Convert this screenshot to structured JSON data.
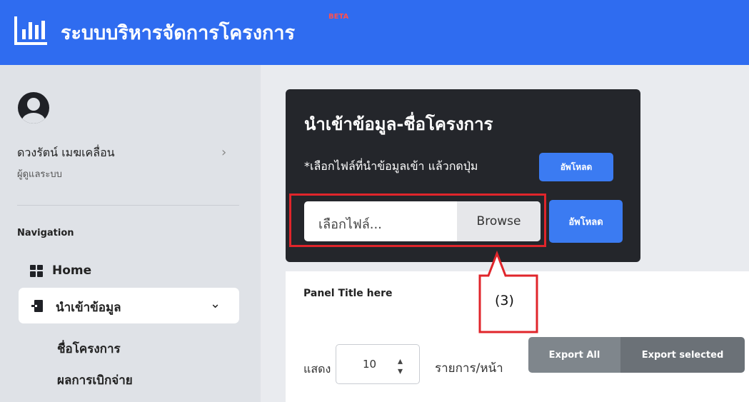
{
  "header": {
    "app_title": "ระบบบริหารจัดการโครงการ",
    "beta_badge": "BETA",
    "logo_icon": "bar-chart-icon"
  },
  "sidebar": {
    "user": {
      "name": "ดวงรัตน์ เมฆเคลื่อน",
      "role": "ผู้ดูแลระบบ"
    },
    "nav_heading": "Navigation",
    "items": [
      {
        "label": "Home",
        "icon": "dashboard-grid-icon"
      },
      {
        "label": "นำเข้าข้อมูล",
        "icon": "file-import-icon",
        "expanded": true,
        "children": [
          "ชื่อโครงการ",
          "ผลการเบิกจ่าย"
        ]
      }
    ]
  },
  "import_card": {
    "title": "นำเข้าข้อมูล-ชื่อโครงการ",
    "hint": "*เลือกไฟล์ที่นำข้อมูลเข้า แล้วกดปุ่ม",
    "upload_label": "อัพโหลด",
    "file_placeholder": "เลือกไฟล์...",
    "browse_label": "Browse"
  },
  "panel": {
    "title": "Panel Title here",
    "show_label": "แสดง",
    "page_size": "10",
    "per_page_label": "รายการ/หน้า",
    "export_all_label": "Export All",
    "export_selected_label": "Export selected"
  },
  "annotation": {
    "label": "(3)",
    "color": "#e0252b"
  },
  "colors": {
    "topbar": "#2f6cf0",
    "upload_button": "#3b7bf2",
    "card_bg": "#24262b"
  }
}
